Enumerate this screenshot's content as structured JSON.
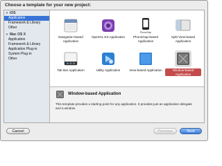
{
  "dialog": {
    "title": "Choose a template for your new project:"
  },
  "sidebar": {
    "groups": [
      {
        "label": "iOS",
        "items": [
          "Application",
          "Framework & Library",
          "Other"
        ]
      },
      {
        "label": "Mac OS X",
        "items": [
          "Application",
          "Framework & Library",
          "Application Plug-in",
          "System Plug-in",
          "Other"
        ]
      }
    ],
    "selected": "iOS/Application"
  },
  "templates": [
    {
      "label": "Navigation-based Application",
      "icon": "navigation-app-icon"
    },
    {
      "label": "OpenGL ES Application",
      "icon": "opengl-app-icon"
    },
    {
      "label": "PhoneGap-based Application",
      "icon": "phonegap-app-icon",
      "icon_caption": "PhoneGap"
    },
    {
      "label": "Split View-based Application",
      "icon": "splitview-app-icon"
    },
    {
      "label": "Tab Bar Application",
      "icon": "tabbar-app-icon"
    },
    {
      "label": "Utility Application",
      "icon": "utility-app-icon"
    },
    {
      "label": "View-based Application",
      "icon": "viewbased-app-icon"
    },
    {
      "label": "Window-based Application",
      "icon": "windowbased-app-icon",
      "selected": true
    }
  ],
  "description": {
    "title": "Window-based Application",
    "body": "This template provides a starting point for any application. It provides just an application delegate and a window."
  },
  "buttons": {
    "cancel": "Cancel",
    "previous": "Previous",
    "next": "Next"
  },
  "colors": {
    "selection": "#3874d8",
    "selected_label": "#c44b4b",
    "primary_button": "#3b7fe0"
  }
}
